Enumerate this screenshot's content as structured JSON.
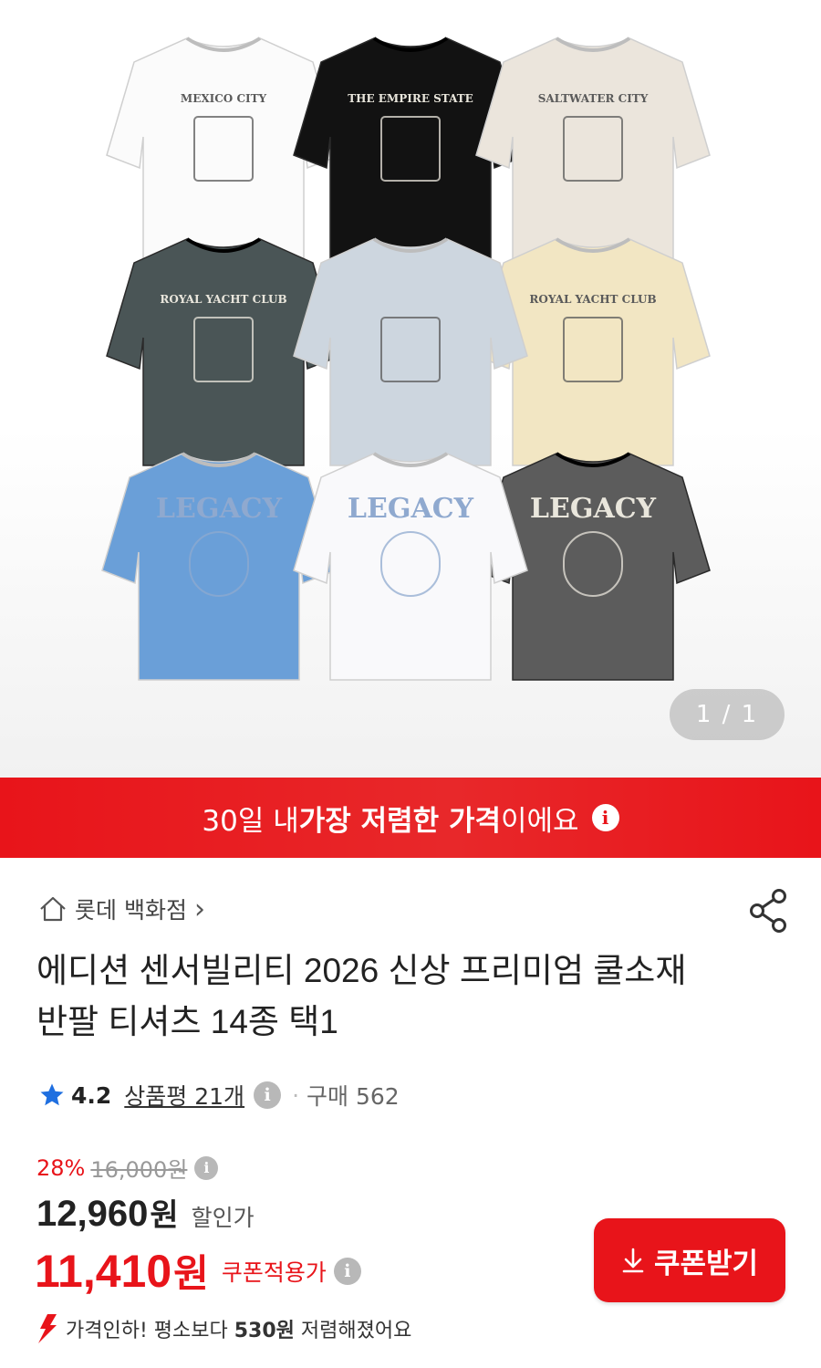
{
  "gallery": {
    "pager": "1 / 1",
    "shirts": [
      {
        "name": "white-mexico-city",
        "color": "#fbfbfb",
        "print": "MEXICO CITY"
      },
      {
        "name": "black-empire-state",
        "color": "#121212",
        "print": "THE EMPIRE STATE"
      },
      {
        "name": "ivory-saltwater-city",
        "color": "#ebe5dc",
        "print": "SALTWATER CITY"
      },
      {
        "name": "charcoal-royal-yacht",
        "color": "#4a5556",
        "print": "ROYAL YACHT CLUB"
      },
      {
        "name": "lightblue-building",
        "color": "#cdd6df",
        "print": ""
      },
      {
        "name": "cream-royal-yacht",
        "color": "#f2e6c3",
        "print": "ROYAL YACHT CLUB"
      },
      {
        "name": "blue-legacy",
        "color": "#6a9fd8",
        "print": "LEGACY"
      },
      {
        "name": "white-legacy",
        "color": "#f9f9fb",
        "print": "LEGACY"
      },
      {
        "name": "grey-legacy",
        "color": "#5c5c5c",
        "print": "LEGACY"
      }
    ]
  },
  "banner": {
    "prefix": "30일 내 ",
    "highlight": "가장 저렴한 가격",
    "suffix": "이에요",
    "info": "i"
  },
  "store": {
    "name": "롯데 백화점",
    "chevron": "›"
  },
  "product": {
    "title": "에디션 센서빌리티 2026 신상 프리미엄 쿨소재 반팔 티셔츠 14종 택1"
  },
  "rating": {
    "score": "4.2",
    "reviews": "상품평 21개",
    "dot": "·",
    "purchases": "구매 562"
  },
  "price": {
    "discount_rate": "28%",
    "original": "16,000원",
    "sale_price": "12,960",
    "sale_unit": "원",
    "sale_label": "할인가",
    "coupon_price": "11,410",
    "coupon_unit": "원",
    "coupon_label": "쿠폰적용가",
    "info": "i"
  },
  "coupon_button": {
    "label": "쿠폰받기",
    "icon": "download-arrow-icon"
  },
  "price_drop": {
    "prefix": "가격인하! 평소보다 ",
    "amount": "530원",
    "suffix": " 저렴해졌어요"
  },
  "colors": {
    "accent": "#e8141a",
    "star": "#1f6fe0"
  }
}
